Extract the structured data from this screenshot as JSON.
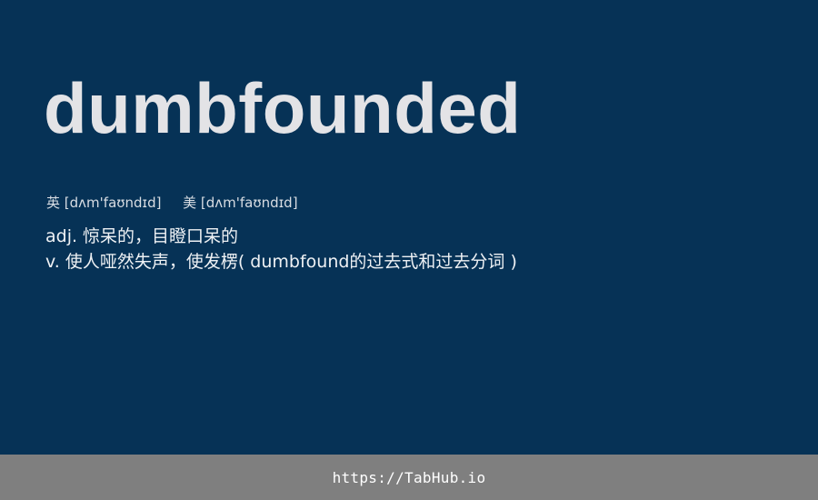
{
  "word": "dumbfounded",
  "phonetics": {
    "uk_label": "英",
    "uk_ipa": "[dʌm'faʊndɪd]",
    "us_label": "美",
    "us_ipa": "[dʌm'faʊndɪd]"
  },
  "definitions": [
    "adj. 惊呆的，目瞪口呆的",
    "v. 使人哑然失声，使发楞( dumbfound的过去式和过去分词 )"
  ],
  "footer": {
    "link_text": "https://TabHub.io"
  },
  "colors": {
    "background": "#063256",
    "footer_background": "#7f7f7f",
    "word_text": "#e3e3e6"
  }
}
